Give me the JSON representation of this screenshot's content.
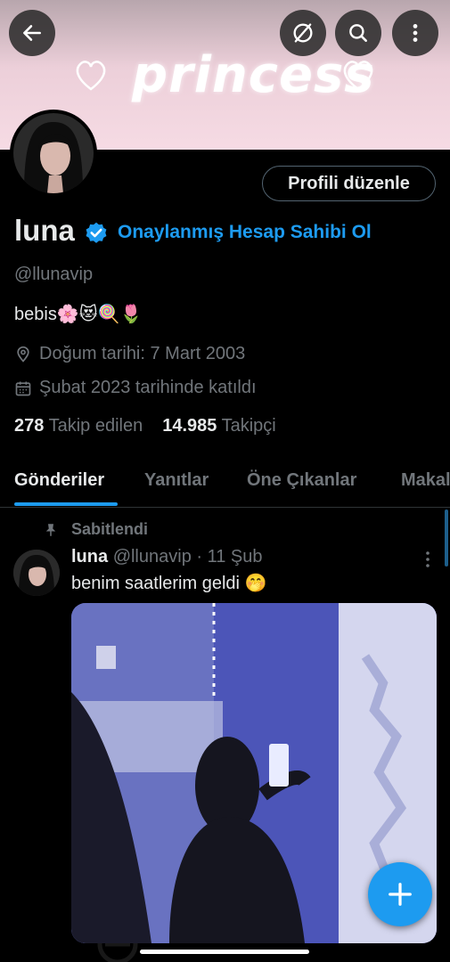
{
  "banner": {
    "text": "princess"
  },
  "profile": {
    "name": "luna",
    "get_verified_label": "Onaylanmış Hesap Sahibi Ol",
    "handle": "@llunavip",
    "bio": "bebis🌸😻🍭🌷",
    "birthday": "Doğum tarihi: 7 Mart 2003",
    "joined": "Şubat 2023 tarihinde katıldı",
    "following_count": "278",
    "following_label": "Takip edilen",
    "followers_count": "14.985",
    "followers_label": "Takipçi",
    "edit_button": "Profili düzenle"
  },
  "tabs": [
    {
      "label": "Gönderiler"
    },
    {
      "label": "Yanıtlar"
    },
    {
      "label": "Öne Çıkanlar"
    },
    {
      "label": "Makal"
    }
  ],
  "pinned_tweet": {
    "pinned_label": "Sabitlendi",
    "author": "luna",
    "handle_time": "@llunavip · 11 Şub",
    "text": "benim saatlerim geldi 🤭"
  },
  "icons": {
    "back": "back-arrow-icon",
    "circle_slash": "circle-slash-icon",
    "search": "search-icon",
    "more": "more-vertical-icon",
    "verified": "verified-badge-icon",
    "location": "location-icon",
    "calendar": "calendar-icon",
    "pin": "pin-icon",
    "compose": "plus-icon"
  },
  "colors": {
    "accent": "#1d9bf0",
    "background": "#000000",
    "muted": "#71767b"
  }
}
